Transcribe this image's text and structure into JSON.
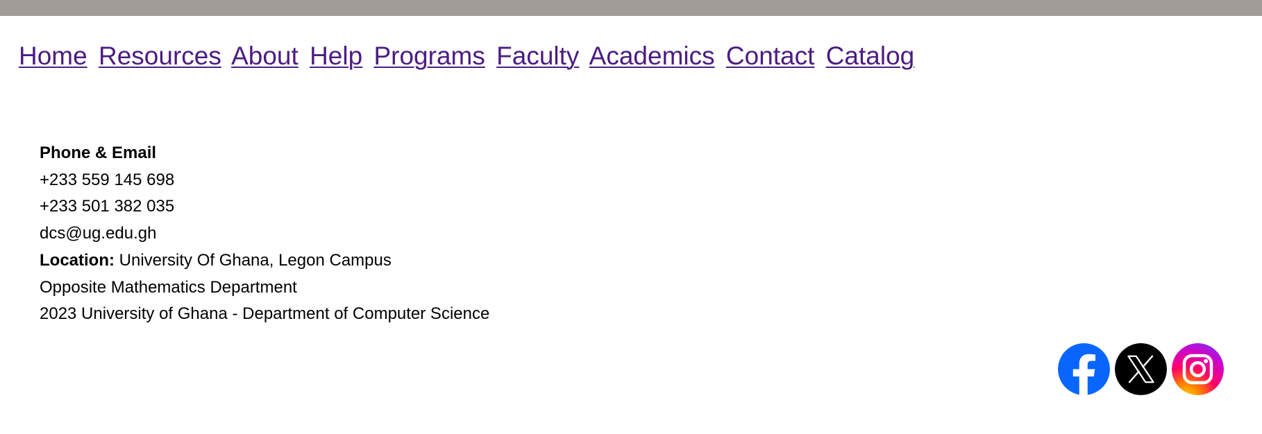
{
  "nav": {
    "links": [
      "Home",
      "Resources",
      "About",
      "Help",
      "Programs",
      "Faculty",
      "Academics",
      "Contact",
      "Catalog"
    ]
  },
  "footer": {
    "heading": "Phone & Email",
    "phone_1": "+233 559 145 698",
    "phone_2": "+233 501 382 035",
    "email": "dcs@ug.edu.gh",
    "location_label": "Location:",
    "location_value": " University Of Ghana, Legon Campus",
    "location_detail": "Opposite Mathematics Department",
    "copyright": "2023 University of Ghana - Department of Computer Science"
  },
  "social": {
    "icons": [
      "facebook-icon",
      "x-icon",
      "instagram-icon"
    ],
    "colors": {
      "facebook": "#0866ff",
      "x": "#000000",
      "instagram_gradient": [
        "#ffd600",
        "#ff7a00",
        "#ff0069",
        "#d300c5",
        "#7638fa"
      ]
    }
  },
  "colors": {
    "top_bar": "#a19c97",
    "link": "#4b1c82"
  }
}
